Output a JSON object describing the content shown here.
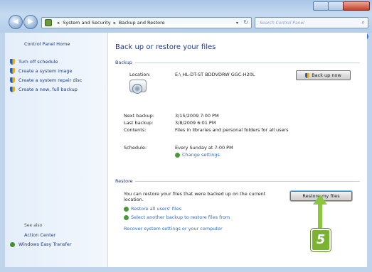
{
  "window": {
    "breadcrumb": [
      "System and Security",
      "Backup and Restore"
    ],
    "search_placeholder": "Search Control Panel"
  },
  "left_pane": {
    "home": "Control Panel Home",
    "items": [
      {
        "label": "Turn off schedule",
        "icon": "shield-icon"
      },
      {
        "label": "Create a system image",
        "icon": "shield-icon"
      },
      {
        "label": "Create a system repair disc",
        "icon": "shield-icon"
      },
      {
        "label": "Create a new, full backup",
        "icon": "shield-icon"
      }
    ],
    "see_also": "See also",
    "see_also_links": [
      {
        "label": "Action Center",
        "icon": ""
      },
      {
        "label": "Windows Easy Transfer",
        "icon": "transfer-icon"
      }
    ]
  },
  "main": {
    "title": "Back up or restore your files",
    "backup": {
      "heading": "Backup",
      "location_label": "Location:",
      "location_value": "E:\\ HL-DT-ST BDDVDRW GGC-H20L",
      "backup_now": "Back up now",
      "next_backup_label": "Next backup:",
      "next_backup_value": "3/15/2009 7:00 PM",
      "last_backup_label": "Last backup:",
      "last_backup_value": "3/8/2009 6:01 PM",
      "contents_label": "Contents:",
      "contents_value": "Files in libraries and personal folders for all users",
      "schedule_label": "Schedule:",
      "schedule_value": "Every Sunday at 7:00 PM",
      "change_settings": "Change settings"
    },
    "restore": {
      "heading": "Restore",
      "description": "You can restore your files that were backed up on the current location.",
      "restore_button": "Restore my files",
      "link_all_users": "Restore all users' files",
      "link_another_backup": "Select another backup to restore files from",
      "link_recover": "Recover system settings or your computer"
    }
  },
  "callout": {
    "step": "5",
    "color": "#8cc63f"
  }
}
